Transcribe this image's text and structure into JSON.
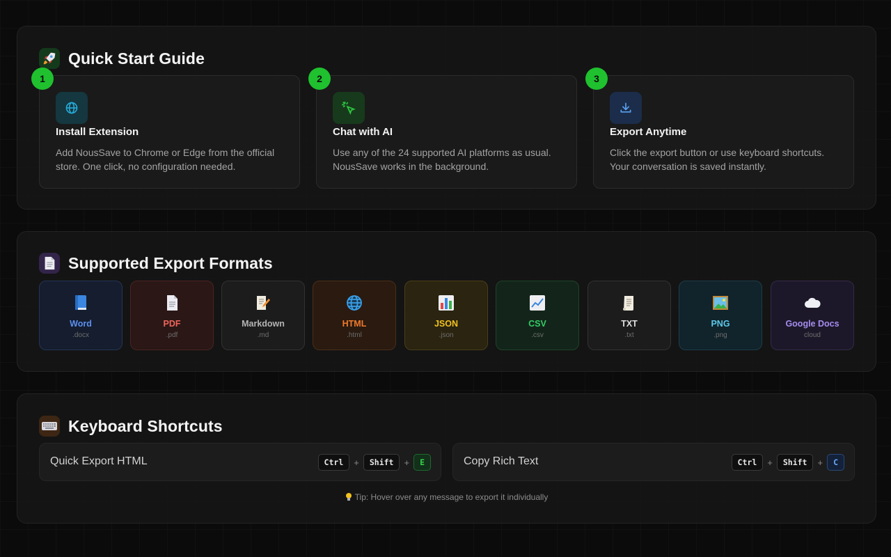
{
  "quick_start": {
    "title": "Quick Start Guide",
    "icon": "rocket-icon",
    "steps": [
      {
        "number": "1",
        "icon": "globe-icon",
        "title": "Install Extension",
        "desc": "Add NousSave to Chrome or Edge from the official store. One click, no configuration needed.",
        "accent": "#27a9d6"
      },
      {
        "number": "2",
        "icon": "cursor-click-icon",
        "title": "Chat with AI",
        "desc": "Use any of the 24 supported AI platforms as usual. NousSave works in the background.",
        "accent": "#2ec440"
      },
      {
        "number": "3",
        "icon": "download-icon",
        "title": "Export Anytime",
        "desc": "Click the export button or use keyboard shortcuts. Your conversation is saved instantly.",
        "accent": "#5aa0f0"
      }
    ]
  },
  "formats": {
    "title": "Supported Export Formats",
    "icon": "document-icon",
    "items": [
      {
        "name": "Word",
        "ext": ".docx",
        "icon": "book-icon",
        "color": "#5b8ff0"
      },
      {
        "name": "PDF",
        "ext": ".pdf",
        "icon": "page-icon",
        "color": "#f0655b"
      },
      {
        "name": "Markdown",
        "ext": ".md",
        "icon": "memo-icon",
        "color": "#b4b4b4"
      },
      {
        "name": "HTML",
        "ext": ".html",
        "icon": "globe-icon",
        "color": "#f07a2e"
      },
      {
        "name": "JSON",
        "ext": ".json",
        "icon": "bar-chart-icon",
        "color": "#f2c21e"
      },
      {
        "name": "CSV",
        "ext": ".csv",
        "icon": "line-chart-icon",
        "color": "#33cc66"
      },
      {
        "name": "TXT",
        "ext": ".txt",
        "icon": "scroll-icon",
        "color": "#e0e0e0"
      },
      {
        "name": "PNG",
        "ext": ".png",
        "icon": "picture-icon",
        "color": "#5cc8e8"
      },
      {
        "name": "Google Docs",
        "ext": "cloud",
        "icon": "cloud-icon",
        "color": "#a58cf0"
      }
    ]
  },
  "shortcuts": {
    "title": "Keyboard Shortcuts",
    "icon": "keyboard-icon",
    "items": [
      {
        "label": "Quick Export HTML",
        "keys": [
          "Ctrl",
          "Shift",
          "E"
        ],
        "accent": "#2ec440"
      },
      {
        "label": "Copy Rich Text",
        "keys": [
          "Ctrl",
          "Shift",
          "C"
        ],
        "accent": "#5aa0f0"
      }
    ],
    "tip": "Tip: Hover over any message to export it individually",
    "tip_icon": "lightbulb-icon"
  }
}
